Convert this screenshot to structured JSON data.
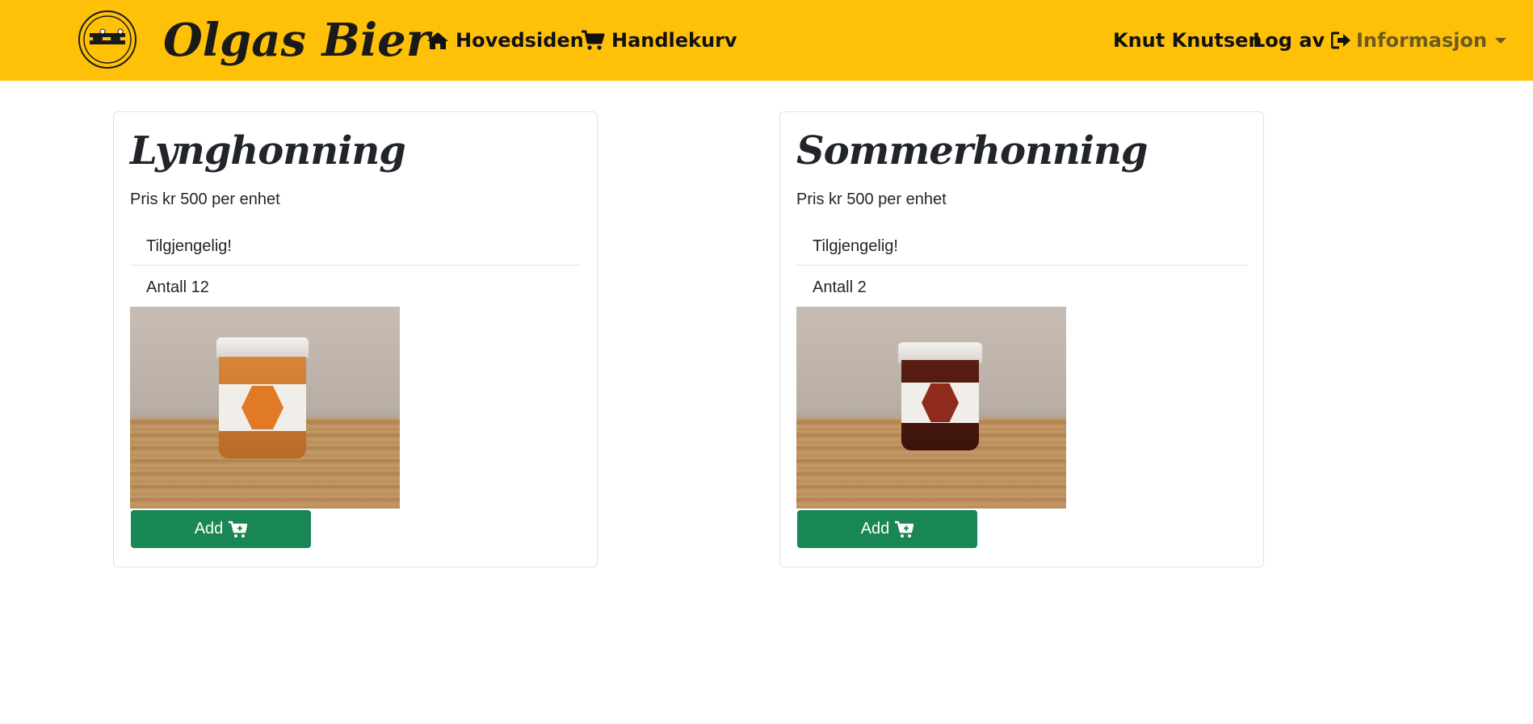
{
  "navbar": {
    "brand": "Olgas Bier",
    "logo_text": "OLGAS BIER",
    "links": {
      "home": "Hovedsiden",
      "cart": "Handlekurv",
      "user": "Knut Knutsen",
      "logout": "Log av",
      "info": "Informasjon"
    },
    "background_color": "#ffc107"
  },
  "products": [
    {
      "name": "Lynghonning",
      "price_text": "Pris kr 500 per enhet",
      "availability": "Tilgjengelig!",
      "quantity_text": "Antall 12",
      "image_alt": "Lynghonning",
      "add_label": "Add"
    },
    {
      "name": "Sommerhonning",
      "price_text": "Pris kr 500 per enhet",
      "availability": "Tilgjengelig!",
      "quantity_text": "Antall 2",
      "image_alt": "Sommerhonning",
      "add_label": "Add"
    }
  ],
  "colors": {
    "button": "#198754",
    "border": "#dee2e6"
  }
}
